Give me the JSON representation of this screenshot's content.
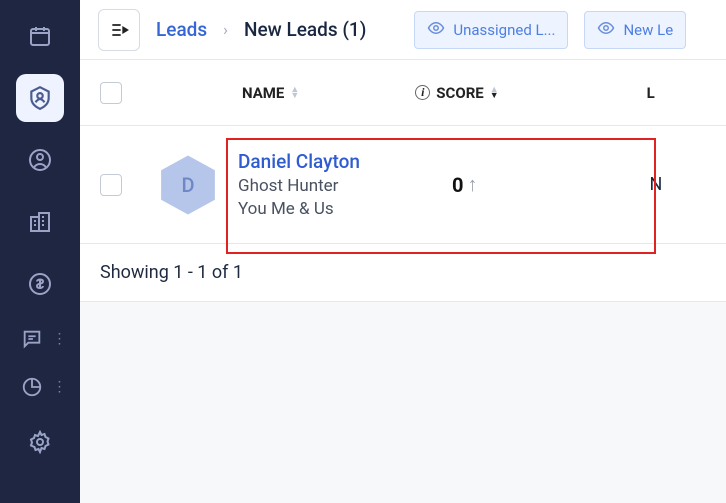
{
  "breadcrumb": {
    "root": "Leads",
    "current": "New Leads (1)"
  },
  "filters": {
    "unassigned": "Unassigned L...",
    "newleads": "New Le"
  },
  "columns": {
    "name": "NAME",
    "score": "SCORE",
    "l": "L"
  },
  "lead": {
    "initial": "D",
    "name": "Daniel Clayton",
    "title": "Ghost Hunter",
    "company": "You Me & Us",
    "score": "0",
    "extra": "N"
  },
  "pagination": "Showing 1 - 1 of 1"
}
